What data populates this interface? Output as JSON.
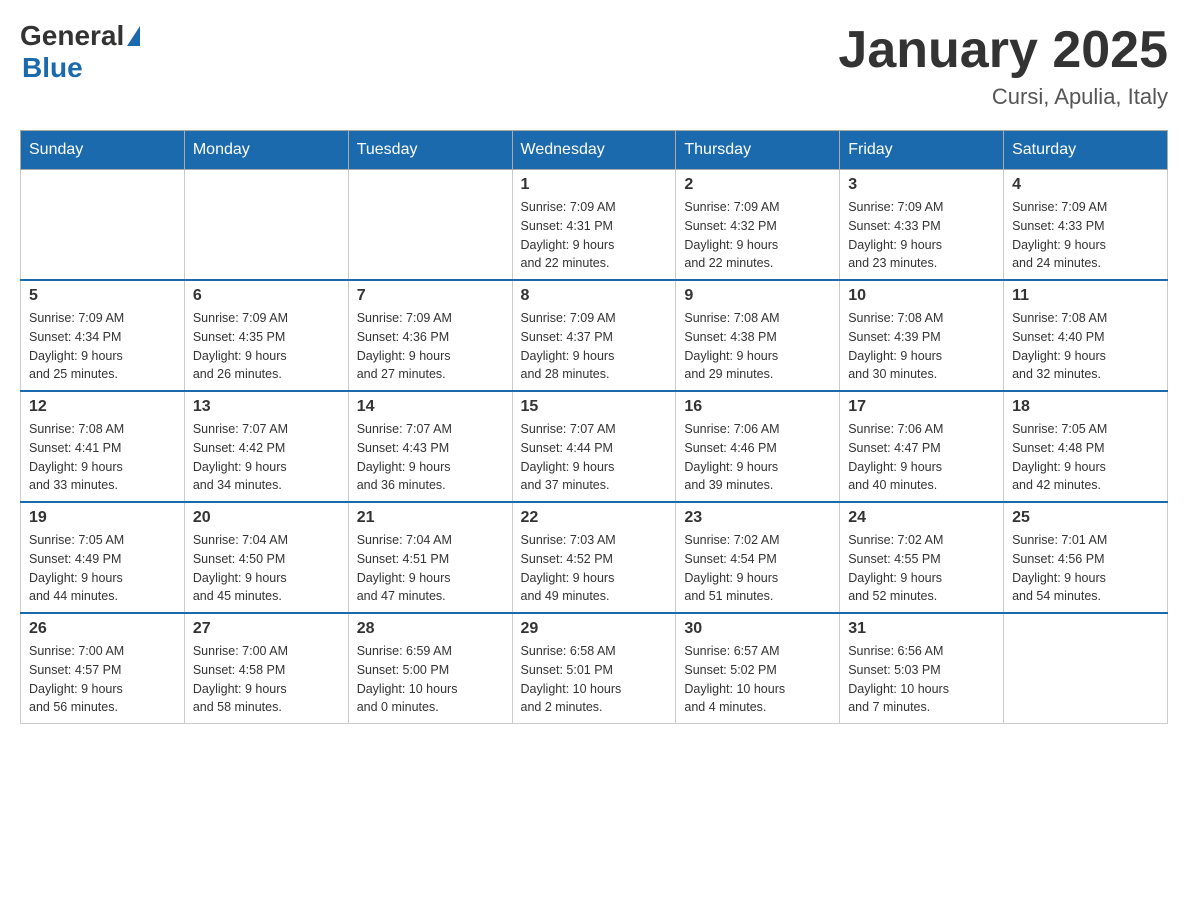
{
  "header": {
    "logo_general": "General",
    "logo_blue": "Blue",
    "title": "January 2025",
    "subtitle": "Cursi, Apulia, Italy"
  },
  "weekdays": [
    "Sunday",
    "Monday",
    "Tuesday",
    "Wednesday",
    "Thursday",
    "Friday",
    "Saturday"
  ],
  "weeks": [
    [
      {
        "day": "",
        "info": ""
      },
      {
        "day": "",
        "info": ""
      },
      {
        "day": "",
        "info": ""
      },
      {
        "day": "1",
        "info": "Sunrise: 7:09 AM\nSunset: 4:31 PM\nDaylight: 9 hours\nand 22 minutes."
      },
      {
        "day": "2",
        "info": "Sunrise: 7:09 AM\nSunset: 4:32 PM\nDaylight: 9 hours\nand 22 minutes."
      },
      {
        "day": "3",
        "info": "Sunrise: 7:09 AM\nSunset: 4:33 PM\nDaylight: 9 hours\nand 23 minutes."
      },
      {
        "day": "4",
        "info": "Sunrise: 7:09 AM\nSunset: 4:33 PM\nDaylight: 9 hours\nand 24 minutes."
      }
    ],
    [
      {
        "day": "5",
        "info": "Sunrise: 7:09 AM\nSunset: 4:34 PM\nDaylight: 9 hours\nand 25 minutes."
      },
      {
        "day": "6",
        "info": "Sunrise: 7:09 AM\nSunset: 4:35 PM\nDaylight: 9 hours\nand 26 minutes."
      },
      {
        "day": "7",
        "info": "Sunrise: 7:09 AM\nSunset: 4:36 PM\nDaylight: 9 hours\nand 27 minutes."
      },
      {
        "day": "8",
        "info": "Sunrise: 7:09 AM\nSunset: 4:37 PM\nDaylight: 9 hours\nand 28 minutes."
      },
      {
        "day": "9",
        "info": "Sunrise: 7:08 AM\nSunset: 4:38 PM\nDaylight: 9 hours\nand 29 minutes."
      },
      {
        "day": "10",
        "info": "Sunrise: 7:08 AM\nSunset: 4:39 PM\nDaylight: 9 hours\nand 30 minutes."
      },
      {
        "day": "11",
        "info": "Sunrise: 7:08 AM\nSunset: 4:40 PM\nDaylight: 9 hours\nand 32 minutes."
      }
    ],
    [
      {
        "day": "12",
        "info": "Sunrise: 7:08 AM\nSunset: 4:41 PM\nDaylight: 9 hours\nand 33 minutes."
      },
      {
        "day": "13",
        "info": "Sunrise: 7:07 AM\nSunset: 4:42 PM\nDaylight: 9 hours\nand 34 minutes."
      },
      {
        "day": "14",
        "info": "Sunrise: 7:07 AM\nSunset: 4:43 PM\nDaylight: 9 hours\nand 36 minutes."
      },
      {
        "day": "15",
        "info": "Sunrise: 7:07 AM\nSunset: 4:44 PM\nDaylight: 9 hours\nand 37 minutes."
      },
      {
        "day": "16",
        "info": "Sunrise: 7:06 AM\nSunset: 4:46 PM\nDaylight: 9 hours\nand 39 minutes."
      },
      {
        "day": "17",
        "info": "Sunrise: 7:06 AM\nSunset: 4:47 PM\nDaylight: 9 hours\nand 40 minutes."
      },
      {
        "day": "18",
        "info": "Sunrise: 7:05 AM\nSunset: 4:48 PM\nDaylight: 9 hours\nand 42 minutes."
      }
    ],
    [
      {
        "day": "19",
        "info": "Sunrise: 7:05 AM\nSunset: 4:49 PM\nDaylight: 9 hours\nand 44 minutes."
      },
      {
        "day": "20",
        "info": "Sunrise: 7:04 AM\nSunset: 4:50 PM\nDaylight: 9 hours\nand 45 minutes."
      },
      {
        "day": "21",
        "info": "Sunrise: 7:04 AM\nSunset: 4:51 PM\nDaylight: 9 hours\nand 47 minutes."
      },
      {
        "day": "22",
        "info": "Sunrise: 7:03 AM\nSunset: 4:52 PM\nDaylight: 9 hours\nand 49 minutes."
      },
      {
        "day": "23",
        "info": "Sunrise: 7:02 AM\nSunset: 4:54 PM\nDaylight: 9 hours\nand 51 minutes."
      },
      {
        "day": "24",
        "info": "Sunrise: 7:02 AM\nSunset: 4:55 PM\nDaylight: 9 hours\nand 52 minutes."
      },
      {
        "day": "25",
        "info": "Sunrise: 7:01 AM\nSunset: 4:56 PM\nDaylight: 9 hours\nand 54 minutes."
      }
    ],
    [
      {
        "day": "26",
        "info": "Sunrise: 7:00 AM\nSunset: 4:57 PM\nDaylight: 9 hours\nand 56 minutes."
      },
      {
        "day": "27",
        "info": "Sunrise: 7:00 AM\nSunset: 4:58 PM\nDaylight: 9 hours\nand 58 minutes."
      },
      {
        "day": "28",
        "info": "Sunrise: 6:59 AM\nSunset: 5:00 PM\nDaylight: 10 hours\nand 0 minutes."
      },
      {
        "day": "29",
        "info": "Sunrise: 6:58 AM\nSunset: 5:01 PM\nDaylight: 10 hours\nand 2 minutes."
      },
      {
        "day": "30",
        "info": "Sunrise: 6:57 AM\nSunset: 5:02 PM\nDaylight: 10 hours\nand 4 minutes."
      },
      {
        "day": "31",
        "info": "Sunrise: 6:56 AM\nSunset: 5:03 PM\nDaylight: 10 hours\nand 7 minutes."
      },
      {
        "day": "",
        "info": ""
      }
    ]
  ]
}
